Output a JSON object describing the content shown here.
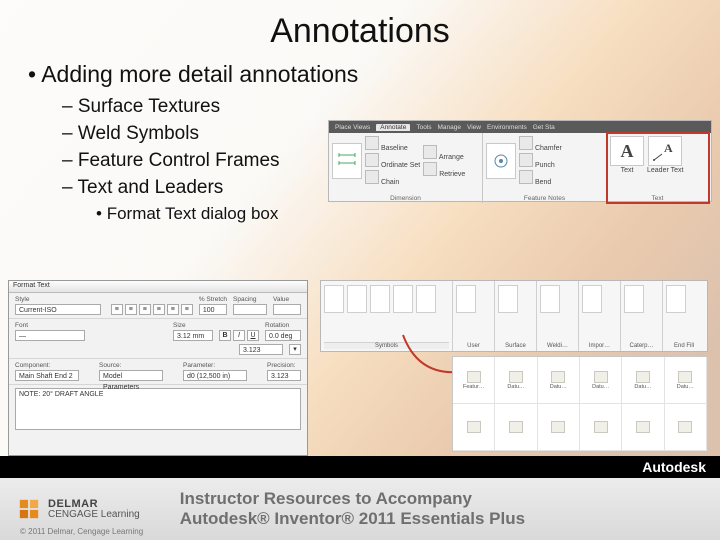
{
  "title": "Annotations",
  "bullets": {
    "l1": "Adding more detail annotations",
    "l2": [
      "Surface Textures",
      "Weld Symbols",
      "Feature Control Frames",
      "Text and Leaders"
    ],
    "l3": "Format Text dialog box"
  },
  "ribbon1": {
    "tabs": [
      "Place Views",
      "Annotate",
      "Tools",
      "Manage",
      "View",
      "Environments",
      "Get Sta"
    ],
    "active_tab": "Annotate",
    "dimension_panel": {
      "big": "Dimension",
      "items": [
        "Baseline",
        "Ordinate Set",
        "Chain"
      ],
      "items2": [
        "Arrange",
        "Retrieve"
      ],
      "label": "Dimension"
    },
    "feature_panel": {
      "items": [
        "Hole and Thread",
        "Chamfer",
        "Punch",
        "Bend"
      ],
      "label": "Feature Notes"
    },
    "text_panel": {
      "items": [
        "Text",
        "Leader Text"
      ],
      "label": "Text"
    }
  },
  "dlg": {
    "title": "Format Text",
    "style_label": "Style",
    "style_value": "Current-ISO",
    "stretch_label": "% Stretch",
    "stretch_value": "100",
    "spacing_label": "Spacing",
    "value_label": "Value",
    "font_label": "Font",
    "font_value": "—",
    "size_label": "Size",
    "size_value": "3.12 mm",
    "rotation_label": "Rotation",
    "rotation_value": "0.0 deg",
    "component_label": "Component:",
    "component_value": "Main Shaft End 2",
    "source_label": "Source:",
    "source_value": "Model Parameters",
    "parameter_label": "Parameter:",
    "parameter_value": "d0 (12,500 in)",
    "precision_label": "Precision:",
    "precision_value": "3.123",
    "note": "NOTE: 20° DRAFT ANGLE"
  },
  "ribbon2": {
    "panels": [
      {
        "label": "User",
        "icons": 1
      },
      {
        "label": "Surface",
        "icons": 1
      },
      {
        "label": "Weldi…",
        "icons": 1
      },
      {
        "label": "Impor…",
        "icons": 1
      },
      {
        "label": "Caterp…",
        "icons": 1
      },
      {
        "label": "End Fill",
        "icons": 1
      }
    ],
    "symbols_label": "Symbols"
  },
  "anno_grid": [
    "Featur…",
    "Datu…",
    "Datu…",
    "Datu…",
    "Datu…",
    "Datu…",
    "",
    "",
    "",
    "",
    "",
    "",
    "",
    "",
    "",
    "",
    "",
    ""
  ],
  "footer": {
    "autodesk": "Autodesk",
    "delmar_brand": "DELMAR",
    "delmar_sub": "CENGAGE Learning",
    "copyright": "© 2011 Delmar, Cengage Learning",
    "line1": "Instructor Resources to Accompany",
    "line2": "Autodesk® Inventor® 2011 Essentials Plus"
  }
}
